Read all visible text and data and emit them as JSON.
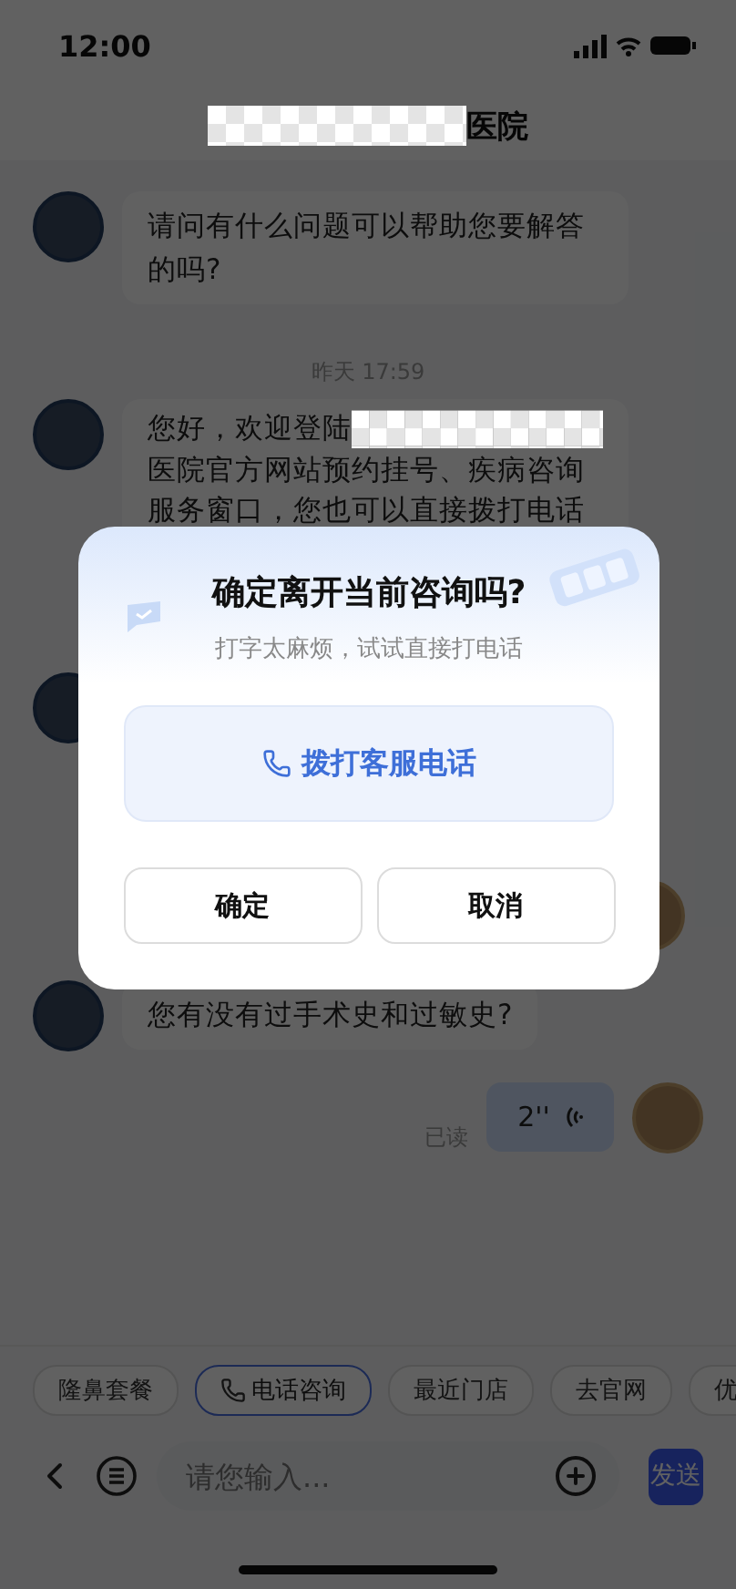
{
  "status_bar": {
    "time": "12:00"
  },
  "header": {
    "title_suffix": "医院"
  },
  "messages": [
    {
      "kind": "text",
      "outgoing": false,
      "text": "请问有什么问题可以帮助您要解答的吗?"
    },
    {
      "kind": "time",
      "text": "昨天 17:59"
    },
    {
      "kind": "redacted_text",
      "outgoing": false,
      "before": "您好，欢迎登陆",
      "after": "医院官方网站预约挂号、疾病咨询服务窗口，您也可以直接拨打电话"
    },
    {
      "kind": "covered",
      "outgoing": false
    },
    {
      "kind": "covered",
      "outgoing": true
    },
    {
      "kind": "text",
      "outgoing": false,
      "text": "您有没有过手术史和过敏史?"
    },
    {
      "kind": "voice",
      "outgoing": true,
      "duration": "2''",
      "receipt": "已读"
    }
  ],
  "quick_replies": [
    {
      "label": "隆鼻套餐",
      "kind": "plain"
    },
    {
      "label": "电话咨询",
      "kind": "phone"
    },
    {
      "label": "最近门店",
      "kind": "plain"
    },
    {
      "label": "去官网",
      "kind": "plain"
    },
    {
      "label": "优",
      "kind": "plain"
    }
  ],
  "input": {
    "placeholder": "请您输入...",
    "send": "发送"
  },
  "dialog": {
    "title": "确定离开当前咨询吗?",
    "subtitle": "打字太麻烦，试试直接打电话",
    "call_button": "拨打客服电话",
    "buttons": [
      "确定",
      "取消"
    ]
  }
}
